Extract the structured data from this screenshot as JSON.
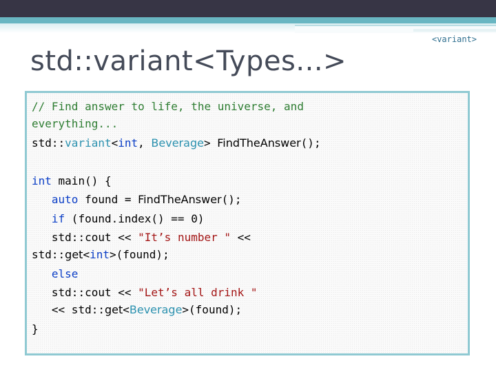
{
  "page": {
    "tag": "<variant>",
    "title": "std::variant<Types...>"
  },
  "code": {
    "l1": "// Find answer to life, the universe, and",
    "l2": "everything...",
    "l3_a": "std::",
    "l3_b": "variant",
    "l3_c": "<",
    "l3_d": "int",
    "l3_e": ", ",
    "l3_f": "Beverage",
    "l3_g": "> ",
    "l3_h": "FindTheAnswer",
    "l3_i": "();",
    "l5_a": "int",
    "l5_b": " main() {",
    "l6_ind": "   ",
    "l6_a": "auto",
    "l6_b": " found = ",
    "l6_c": "FindTheAnswer",
    "l6_d": "();",
    "l7_ind": "   ",
    "l7_a": "if",
    "l7_b": " (found.index() == 0)",
    "l8_ind": "   ",
    "l8_a": "std::cout << ",
    "l8_b": "\"It’s number \"",
    "l8_c": " <<",
    "l9_a": "std::",
    "l9_b": "get",
    "l9_c": "<",
    "l9_d": "int",
    "l9_e": ">(found);",
    "l10_ind": "   ",
    "l10_a": "else",
    "l11_ind": "   ",
    "l11_a": "std::cout << ",
    "l11_b": "\"Let’s all drink \"",
    "l12_ind": "   ",
    "l12_a": "<< std::",
    "l12_b": "get",
    "l12_c": "<",
    "l12_d": "Beverage",
    "l12_e": ">(found);",
    "l13": "}"
  }
}
